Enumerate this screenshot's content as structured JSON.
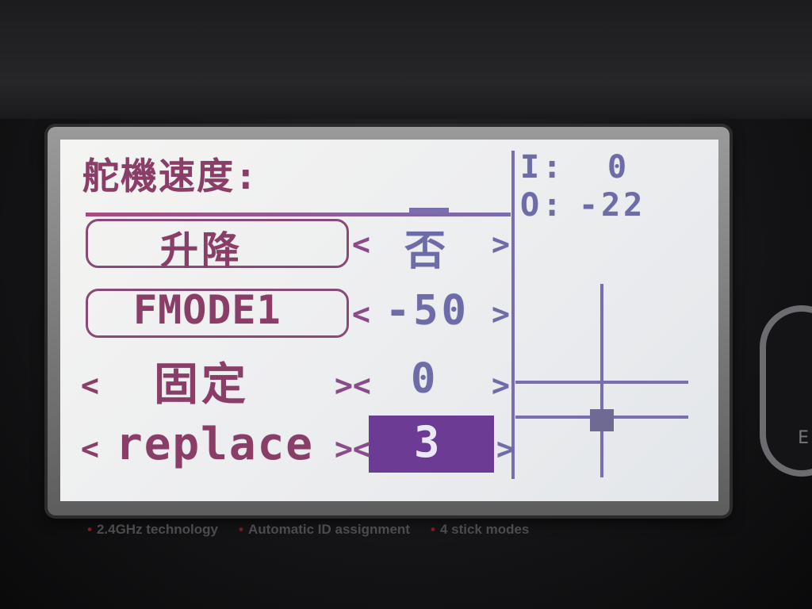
{
  "screen": {
    "title": "舵機速度:",
    "io": {
      "i_label": "I:",
      "i_value": "0",
      "o_label": "O:",
      "o_value": "-22"
    },
    "rows": [
      {
        "label": "升降",
        "value": "否",
        "left_arrow": "<",
        "right_arrow": ">"
      },
      {
        "label": "FMODE1",
        "value": "-50",
        "left_arrow": "<",
        "right_arrow": ">"
      },
      {
        "label": "固定",
        "value": "0",
        "left_arrow": "<",
        "mid_arrows": "><",
        "right_arrow": ">"
      },
      {
        "label": "replace",
        "value": "3",
        "left_arrow": "<",
        "mid_arrows": "><",
        "right_arrow": ">"
      }
    ],
    "selected_row": 3,
    "colors": {
      "title": "#8a3d67",
      "value": "#6d6ca8",
      "highlight": "#6c3b94",
      "grid": "#7a6db0"
    }
  },
  "device": {
    "features": [
      "2.4GHz technology",
      "Automatic ID assignment",
      "4 stick modes"
    ],
    "side_letter": "E"
  }
}
